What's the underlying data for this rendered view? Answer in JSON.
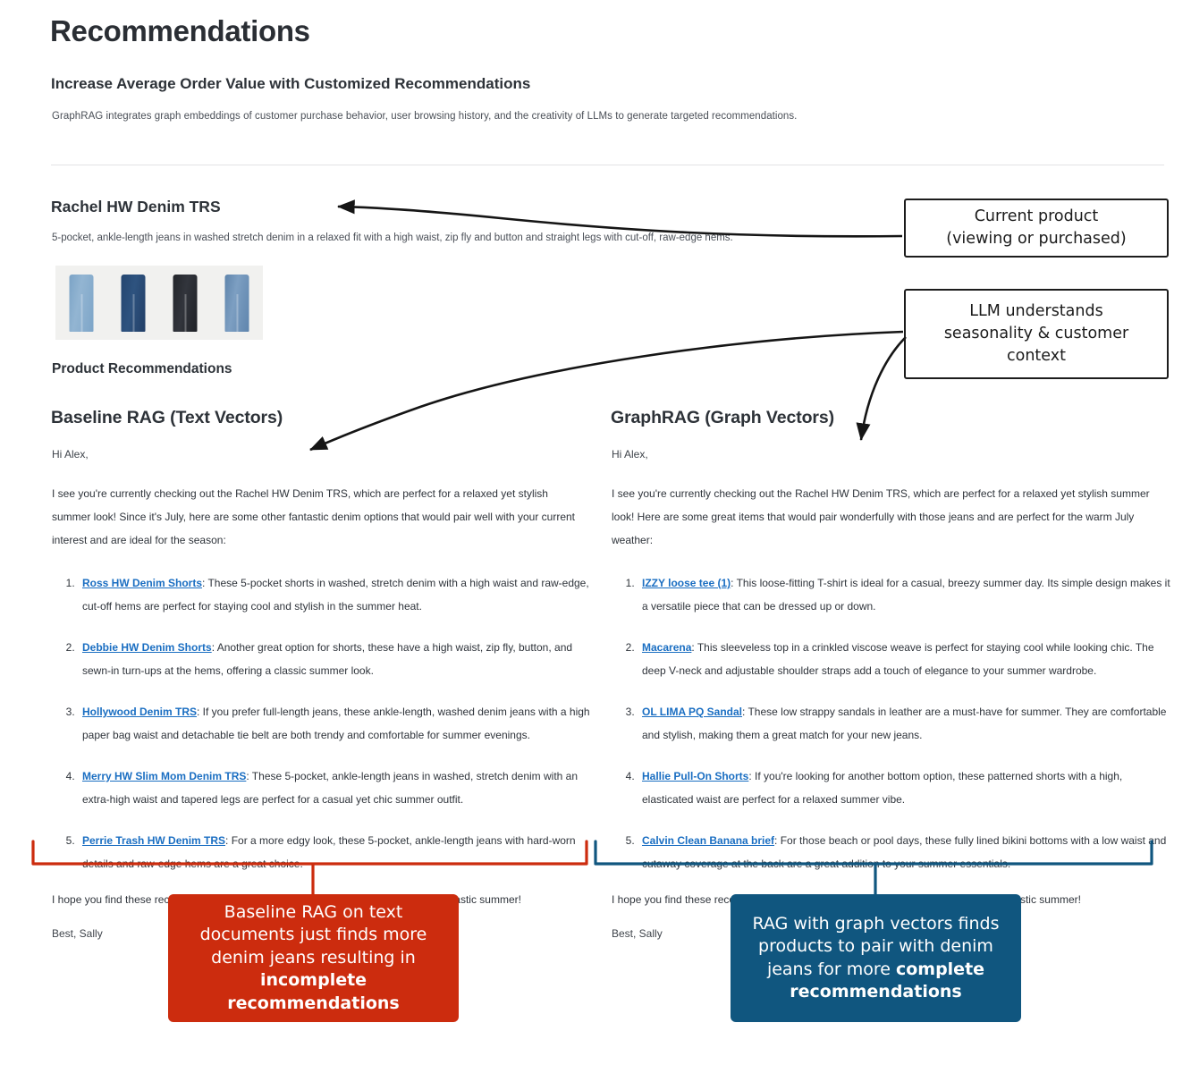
{
  "header": {
    "title": "Recommendations",
    "subtitle": "Increase Average Order Value with Customized Recommendations",
    "intro": "GraphRAG integrates graph embeddings of customer purchase behavior, user browsing history, and the creativity of LLMs to generate targeted recommendations."
  },
  "product": {
    "name": "Rachel HW Denim TRS",
    "description": "5-pocket, ankle-length jeans in washed stretch denim in a relaxed fit with a high waist, zip fly and button and straight legs with cut-off, raw-edge hems.",
    "thumbnails": [
      {
        "name": "light-wash-straight-jeans",
        "color": "#93b5d2"
      },
      {
        "name": "dark-indigo-jeans",
        "color": "#2e537f"
      },
      {
        "name": "black-jeans",
        "color": "#32353c"
      },
      {
        "name": "medium-wash-jeans",
        "color": "#7d9fc2"
      }
    ],
    "recommendations_label": "Product Recommendations"
  },
  "annotations": {
    "current_product": "Current product\n(viewing or purchased)",
    "llm_context": "LLM understands\nseasonality & customer\ncontext"
  },
  "columns": {
    "left": {
      "heading": "Baseline RAG (Text Vectors)",
      "salutation": "Hi Alex,",
      "paragraph": "I see you're currently checking out the Rachel HW Denim TRS, which are perfect for a relaxed yet stylish summer look! Since it's July, here are some other fantastic denim options that would pair well with your current interest and are ideal for the season:",
      "items": [
        {
          "link": "Ross HW Denim Shorts",
          "text": ": These 5-pocket shorts in washed, stretch denim with a high waist and raw-edge, cut-off hems are perfect for staying cool and stylish in the summer heat."
        },
        {
          "link": "Debbie HW Denim Shorts",
          "text": ": Another great option for shorts, these have a high waist, zip fly, button, and sewn-in turn-ups at the hems, offering a classic summer look."
        },
        {
          "link": "Hollywood Denim TRS",
          "text": ": If you prefer full-length jeans, these ankle-length, washed denim jeans with a high paper bag waist and detachable tie belt are both trendy and comfortable for summer evenings."
        },
        {
          "link": "Merry HW Slim Mom Denim TRS",
          "text": ": These 5-pocket, ankle-length jeans in washed, stretch denim with an extra-high waist and tapered legs are perfect for a casual yet chic summer outfit."
        },
        {
          "link": "Perrie Trash HW Denim TRS",
          "text": ": For a more edgy look, these 5-pocket, ankle-length jeans with hard-worn details and raw-edge hems are a great choice."
        }
      ],
      "closing": "I hope you find these recommendations helpful! Enjoy your shopping and have a fantastic summer!",
      "signoff": "Best, Sally"
    },
    "right": {
      "heading": "GraphRAG (Graph Vectors)",
      "salutation": "Hi Alex,",
      "paragraph": "I see you're currently checking out the Rachel HW Denim TRS, which are perfect for a relaxed yet stylish summer look! Here are some great items that would pair wonderfully with those jeans and are perfect for the warm July weather:",
      "items": [
        {
          "link": "IZZY loose tee (1)",
          "text": ": This loose-fitting T-shirt is ideal for a casual, breezy summer day. Its simple design makes it a versatile piece that can be dressed up or down."
        },
        {
          "link": "Macarena",
          "text": ": This sleeveless top in a crinkled viscose weave is perfect for staying cool while looking chic. The deep V-neck and adjustable shoulder straps add a touch of elegance to your summer wardrobe."
        },
        {
          "link": "OL LIMA PQ Sandal",
          "text": ": These low strappy sandals in leather are a must-have for summer. They are comfortable and stylish, making them a great match for your new jeans."
        },
        {
          "link": "Hallie Pull-On Shorts",
          "text": ": If you're looking for another bottom option, these patterned shorts with a high, elasticated waist are perfect for a relaxed summer vibe."
        },
        {
          "link": "Calvin Clean Banana brief",
          "text": ": For those beach or pool days, these fully lined bikini bottoms with a low waist and cutaway coverage at the back are a great addition to your summer essentials."
        }
      ],
      "closing": "I hope you find these recommendations helpful! Enjoy your shopping and have a fantastic summer!",
      "signoff": "Best, Sally"
    }
  },
  "results": {
    "left": {
      "lead": "Baseline RAG on text documents just finds more denim jeans resulting in ",
      "emphasis": "incomplete recommendations",
      "color": "#cc2c0e"
    },
    "right": {
      "lead": "RAG with graph vectors finds products to pair with denim jeans for more ",
      "emphasis": "complete recommendations",
      "color": "#10567f"
    }
  },
  "colors": {
    "link": "#1a6ec2",
    "text": "#2f343b",
    "heading": "#2d3238",
    "annotation_stroke": "#1c1c1c",
    "divider": "#e2e2e4"
  }
}
